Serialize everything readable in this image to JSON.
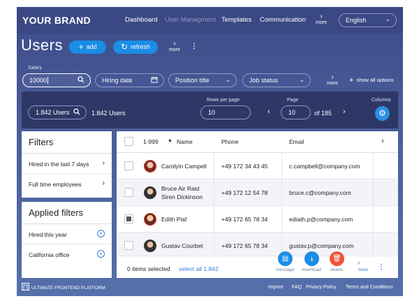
{
  "brand": "YOUR BRAND",
  "nav": {
    "items": [
      "Dashboard",
      "User Managment",
      "Templates",
      "Communication"
    ],
    "more": "more",
    "language": "English"
  },
  "title": {
    "text": "Users",
    "add_label": "add",
    "refresh_label": "refresh",
    "more": "more"
  },
  "filters_row": {
    "salary_label": "Salary",
    "salary_value": "10000",
    "hiring_date_placeholder": "Hiring date",
    "position_placeholder": "Position title",
    "job_status_placeholder": "Job status",
    "more": "more",
    "show_all": "show all options"
  },
  "toolbar": {
    "search_value": "1.842 Users",
    "count_text": "1.842 Users",
    "rows_label": "Rows per page",
    "rows_value": "10",
    "page_label": "Page",
    "page_value": "10",
    "page_of": "of 185",
    "columns_label": "Columns"
  },
  "filters_panel": {
    "title": "Filters",
    "items": [
      "Hired in the last 7 days",
      "Full time employees"
    ]
  },
  "applied_panel": {
    "title": "Applied filters",
    "items": [
      "Hired this year",
      "California office"
    ]
  },
  "table": {
    "range": "1-999",
    "columns": [
      "Name",
      "Phone",
      "Email"
    ],
    "rows": [
      {
        "name": "Carolyin Campell",
        "name2": "",
        "phone": "+49 172 34 43 45",
        "email": "c.campbell@company.com",
        "checked": false
      },
      {
        "name": "Bruce Air Raid",
        "name2": "Siren Dickinson",
        "phone": "+49 172 12 54 78",
        "email": "bruce.c@company.com",
        "checked": false
      },
      {
        "name": "Edith Piaf",
        "name2": "",
        "phone": "+49 172 65 78 34",
        "email": "ediath.p@company.com",
        "checked": true
      },
      {
        "name": "Gustav Courbet",
        "name2": "",
        "phone": "+49 172 65 78 34",
        "email": "gustav.p@company.com",
        "checked": false
      }
    ],
    "selected_text": "0 items selected",
    "select_all": "select all 1.842",
    "actions": [
      "message",
      "download",
      "delete",
      "more"
    ]
  },
  "footer": {
    "platform": "ULTIMATE FRONTEND PLATFORM",
    "links": [
      "Imprint",
      "FAQ",
      "Privacy Policy",
      "Terms and Conditions"
    ]
  },
  "colors": {
    "accent": "#1a8de5",
    "delete": "#f0533a",
    "header": "#3a4883",
    "dark_bar": "#2e3866"
  }
}
